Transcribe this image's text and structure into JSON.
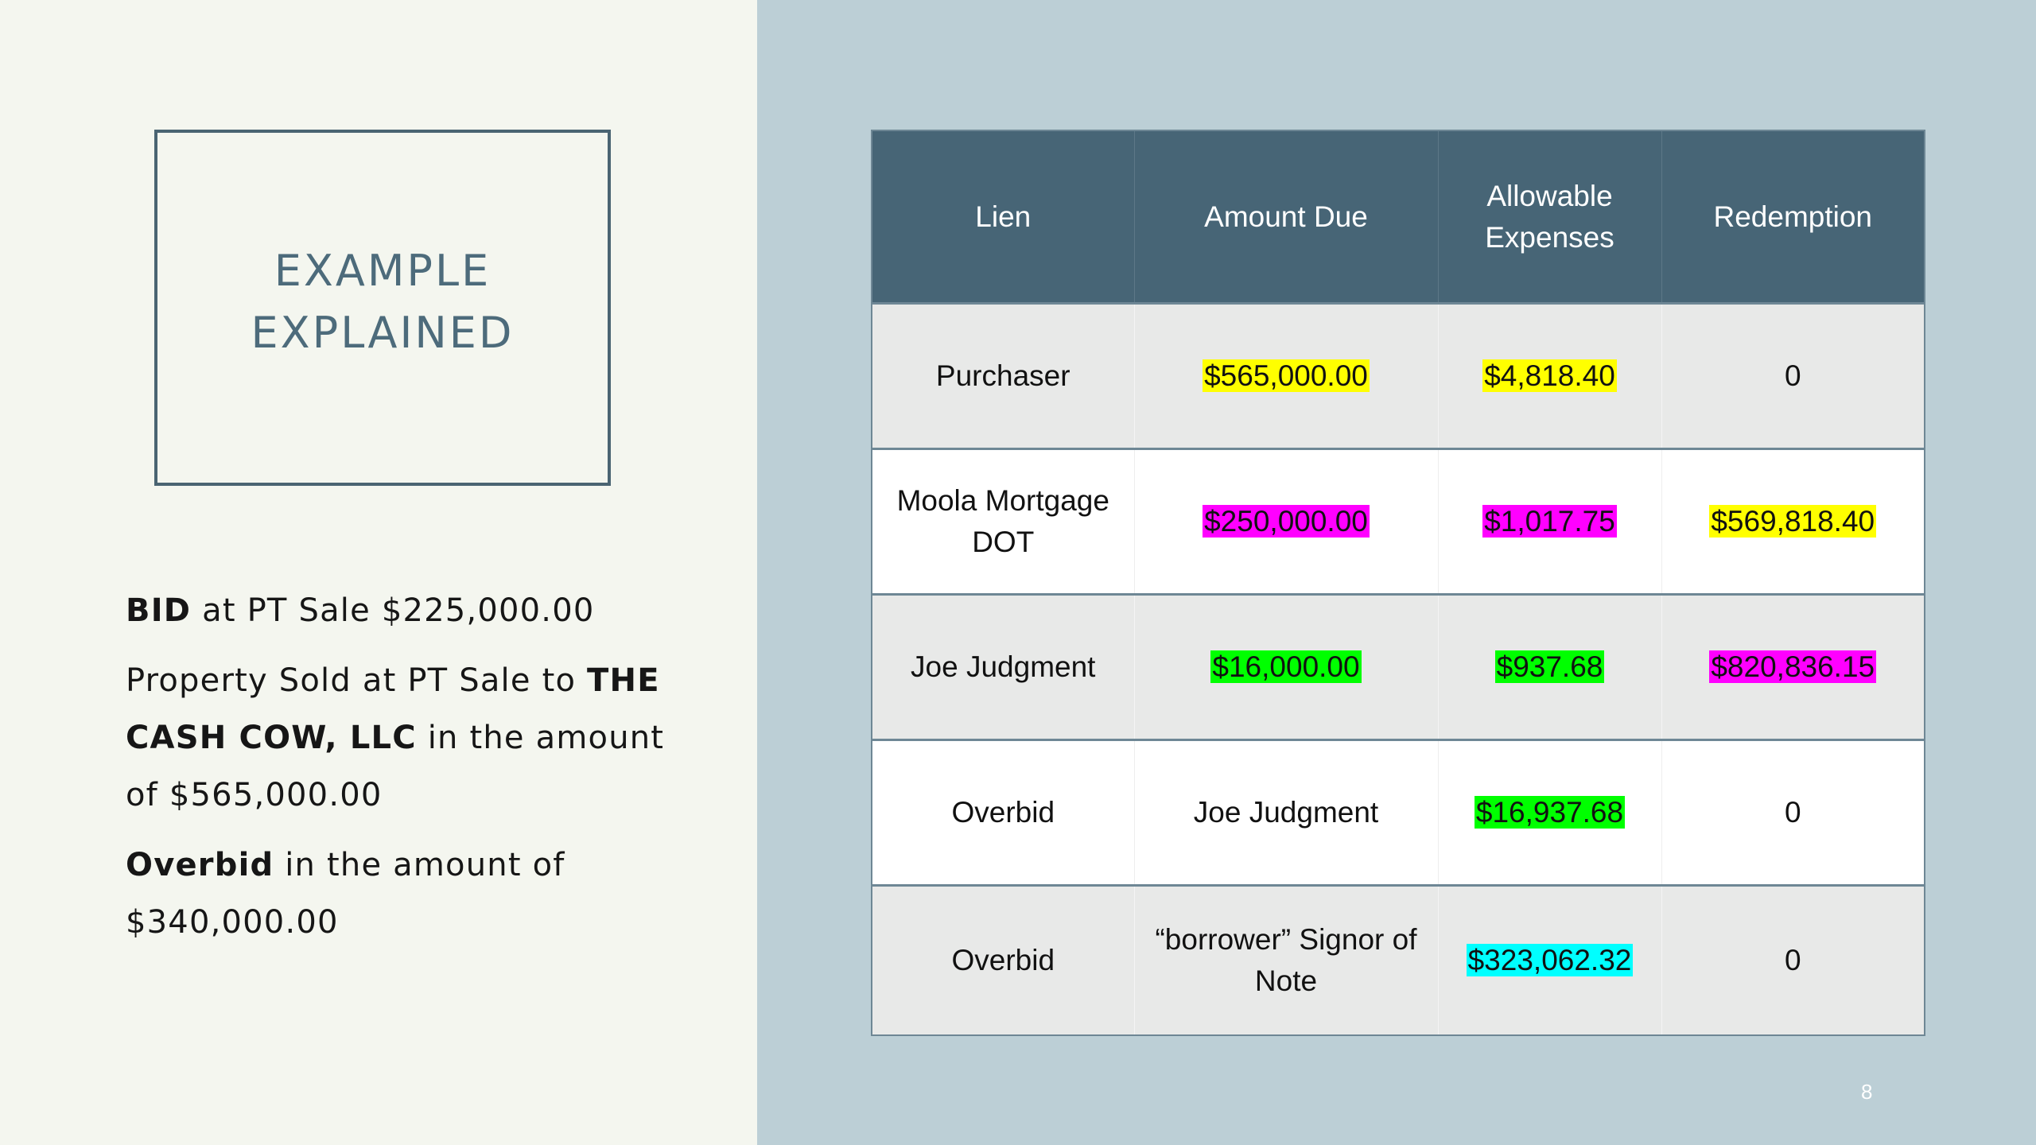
{
  "slide": {
    "title_line1": "EXAMPLE",
    "title_line2": "EXPLAINED",
    "page_number": "8"
  },
  "body": {
    "p1_bold": "BID",
    "p1_rest": " at PT Sale $225,000.00",
    "p2_pre": "Property Sold at PT Sale to ",
    "p2_bold": "THE CASH COW, LLC",
    "p2_rest": " in the amount of $565,000.00",
    "p3_bold": "Overbid",
    "p3_rest": " in the amount of $340,000.00"
  },
  "table": {
    "headers": [
      "Lien",
      "Amount Due",
      "Allowable Expenses",
      "Redemption"
    ],
    "rows": [
      [
        "Purchaser",
        "$565,000.00",
        "$4,818.40",
        "0"
      ],
      [
        "Moola Mortgage DOT",
        "$250,000.00",
        "$1,017.75",
        "$569,818.40"
      ],
      [
        "Joe Judgment",
        "$16,000.00",
        "$937.68",
        "$820,836.15"
      ],
      [
        "Overbid",
        "Joe Judgment",
        "$16,937.68",
        "0"
      ],
      [
        "Overbid",
        "“borrower” Signor of Note",
        "$323,062.32",
        "0"
      ]
    ]
  },
  "colors": {
    "header_bg": "#476576",
    "highlight_yellow": "#ffff00",
    "highlight_magenta": "#ff00ff",
    "highlight_green": "#00ff00",
    "highlight_cyan": "#00ffff"
  }
}
